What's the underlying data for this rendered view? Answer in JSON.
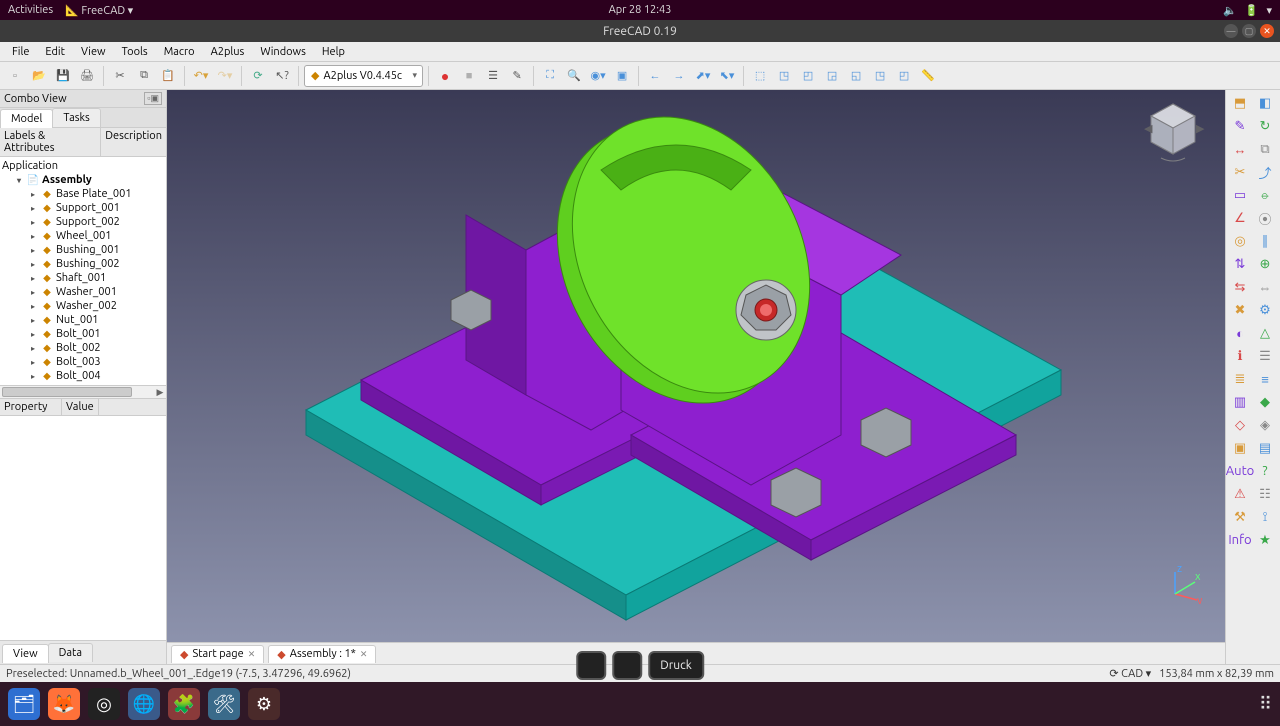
{
  "system": {
    "activities": "Activities",
    "app_menu": "FreeCAD ▾",
    "clock": "Apr 28  12:43"
  },
  "window": {
    "title": "FreeCAD 0.19"
  },
  "menubar": [
    "File",
    "Edit",
    "View",
    "Tools",
    "Macro",
    "A2plus",
    "Windows",
    "Help"
  ],
  "workbench": "A2plus V0.4.45c",
  "combo_view": {
    "title": "Combo View",
    "tabs": {
      "model": "Model",
      "tasks": "Tasks"
    },
    "headers": {
      "labels": "Labels & Attributes",
      "desc": "Description"
    },
    "app_root": "Application",
    "assembly": "Assembly",
    "items": [
      "Base Plate_001",
      "Support_001",
      "Support_002",
      "Wheel_001",
      "Bushing_001",
      "Bushing_002",
      "Shaft_001",
      "Washer_001",
      "Washer_002",
      "Nut_001",
      "Bolt_001",
      "Bolt_002",
      "Bolt_003",
      "Bolt_004"
    ],
    "prop": {
      "property": "Property",
      "value": "Value"
    },
    "bottom": {
      "view": "View",
      "data": "Data"
    }
  },
  "doc_tabs": {
    "start": "Start page",
    "assembly": "Assembly : 1*"
  },
  "osd": {
    "druck": "Druck"
  },
  "status": {
    "preselect": "Preselected: Unnamed.b_Wheel_001_.Edge19 (-7.5, 3.47296, 49.6962)",
    "cad": "CAD",
    "dims": "153,84 mm x 82,39 mm"
  },
  "right_tool_names": [
    "add-part",
    "add-shape",
    "edit-part",
    "update",
    "move",
    "duplicate",
    "cut",
    "export",
    "constraint-plane",
    "constraint-axis",
    "constraint-angle",
    "constraint-coincident",
    "constraint-circular",
    "constraint-parallel",
    "constraint-lock",
    "constraint-center",
    "flip",
    "offset",
    "delete-constraint",
    "solve",
    "toggle-transparent",
    "dof",
    "info",
    "partlist",
    "bom",
    "varlist",
    "misc1",
    "misc2",
    "misc3",
    "misc4",
    "misc5",
    "misc6",
    "view-auto",
    "help",
    "warn",
    "tree-view",
    "settings",
    "measure",
    "info-panel",
    "tip"
  ],
  "right_tool_glyphs": [
    "⬒",
    "◧",
    "✎",
    "↻",
    "↔",
    "⧉",
    "✂",
    "⤴",
    "▭",
    "⦵",
    "∠",
    "⦿",
    "◎",
    "∥",
    "⇅",
    "⊕",
    "⇆",
    "⇔",
    "✖",
    "⚙",
    "◐",
    "△",
    "ℹ",
    "☰",
    "≣",
    "≡",
    "▥",
    "◆",
    "◇",
    "◈",
    "▣",
    "▤",
    "Auto",
    "?",
    "⚠",
    "☷",
    "⚒",
    "⟟",
    "Info",
    "★"
  ]
}
